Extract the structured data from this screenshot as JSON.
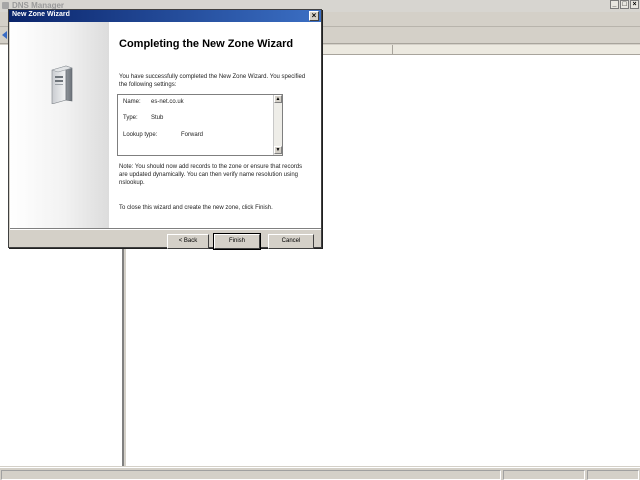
{
  "app": {
    "title": "DNS Manager",
    "window_buttons": [
      "_",
      "□",
      "×"
    ]
  },
  "wizard": {
    "title": "New Zone Wizard",
    "close_glyph": "×",
    "heading": "Completing the New Zone Wizard",
    "intro": "You have successfully completed the New Zone Wizard. You specified the following settings:",
    "settings": [
      {
        "key": "Name:",
        "value": "es-net.co.uk"
      },
      {
        "key": "Type:",
        "value": "Stub"
      },
      {
        "key": "Lookup type:",
        "value": "Forward"
      }
    ],
    "scroll_up": "▲",
    "scroll_down": "▼",
    "note": "Note: You should now add records to the zone or ensure that records are updated dynamically. You can then verify name resolution using nslookup.",
    "close_note": "To close this wizard and create the new zone, click Finish.",
    "buttons": {
      "back": "< Back",
      "finish": "Finish",
      "cancel": "Cancel"
    },
    "icon": "server-icon"
  }
}
